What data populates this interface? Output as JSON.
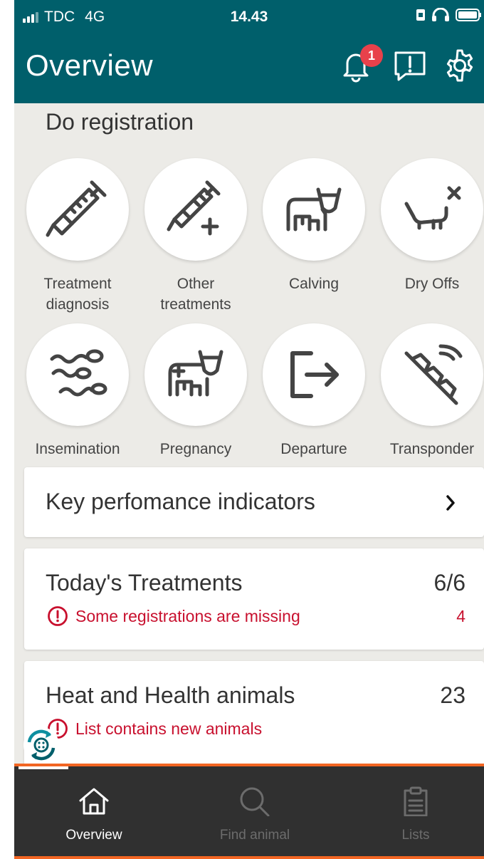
{
  "status_bar": {
    "carrier": "TDC",
    "network": "4G",
    "time": "14.43"
  },
  "header": {
    "title": "Overview",
    "notification_count": "1",
    "icons": [
      "bell-icon",
      "report-icon",
      "gear-icon"
    ]
  },
  "registration": {
    "title": "Do registration",
    "items": [
      {
        "label_line1": "Treatment",
        "label_line2": "diagnosis",
        "icon": "syringe-icon"
      },
      {
        "label_line1": "Other",
        "label_line2": "treatments",
        "icon": "syringe-plus-icon"
      },
      {
        "label_line1": "Calving",
        "label_line2": "",
        "icon": "cow-calf-icon"
      },
      {
        "label_line1": "Dry Offs",
        "label_line2": "",
        "icon": "udder-x-icon"
      },
      {
        "label_line1": "Insemination",
        "label_line2": "",
        "icon": "sperm-icon"
      },
      {
        "label_line1": "Pregnancy",
        "label_line2": "",
        "icon": "pregnant-cow-icon"
      },
      {
        "label_line1": "Departure",
        "label_line2": "",
        "icon": "exit-icon"
      },
      {
        "label_line1": "Transponder",
        "label_line2": "",
        "icon": "transponder-icon"
      }
    ]
  },
  "cards": {
    "kpi": {
      "title": "Key perfomance indicators"
    },
    "treatments": {
      "title": "Today's Treatments",
      "count": "6/6",
      "warning": "Some registrations are missing",
      "warning_count": "4"
    },
    "heat": {
      "title": "Heat and Health animals",
      "count": "23",
      "warning": "List contains new animals"
    }
  },
  "tabbar": {
    "tabs": [
      {
        "label": "Overview",
        "icon": "home-icon",
        "active": true
      },
      {
        "label": "Find animal",
        "icon": "search-icon",
        "active": false
      },
      {
        "label": "Lists",
        "icon": "clipboard-icon",
        "active": false
      }
    ]
  },
  "colors": {
    "primary": "#005f6b",
    "warning": "#c8102e",
    "badge": "#e8414b",
    "tabbar": "#303030",
    "tabbar_border": "#f26522",
    "background": "#ecebe7"
  }
}
